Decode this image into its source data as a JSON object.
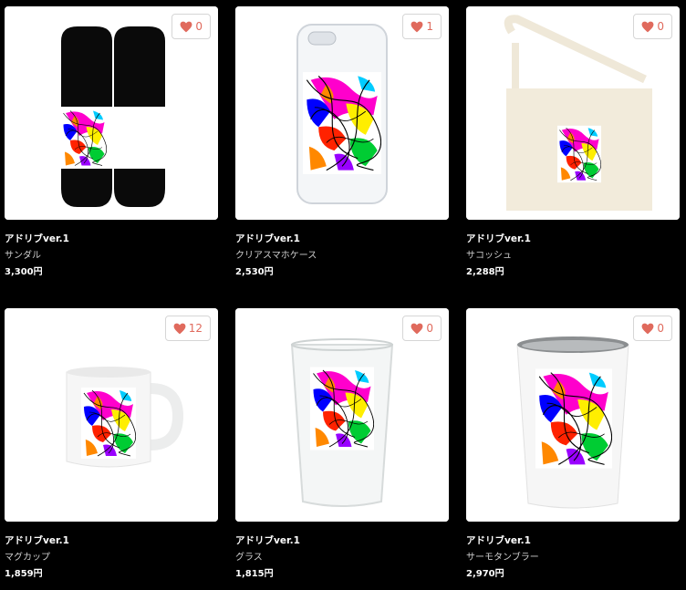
{
  "products": [
    {
      "title": "アドリブver.1",
      "type": "サンダル",
      "price": "3,300円",
      "likes": "0",
      "icon": "sandals-image"
    },
    {
      "title": "アドリブver.1",
      "type": "クリアスマホケース",
      "price": "2,530円",
      "likes": "1",
      "icon": "phone-case-image"
    },
    {
      "title": "アドリブver.1",
      "type": "サコッシュ",
      "price": "2,288円",
      "likes": "0",
      "icon": "sacoche-bag-image"
    },
    {
      "title": "アドリブver.1",
      "type": "マグカップ",
      "price": "1,859円",
      "likes": "12",
      "icon": "mug-image"
    },
    {
      "title": "アドリブver.1",
      "type": "グラス",
      "price": "1,815円",
      "likes": "0",
      "icon": "glass-image"
    },
    {
      "title": "アドリブver.1",
      "type": "サーモタンブラー",
      "price": "2,970円",
      "likes": "0",
      "icon": "thermo-tumbler-image"
    }
  ],
  "colors": {
    "background": "#000000",
    "like_heart": "#e06a5d",
    "card": "#ffffff"
  }
}
